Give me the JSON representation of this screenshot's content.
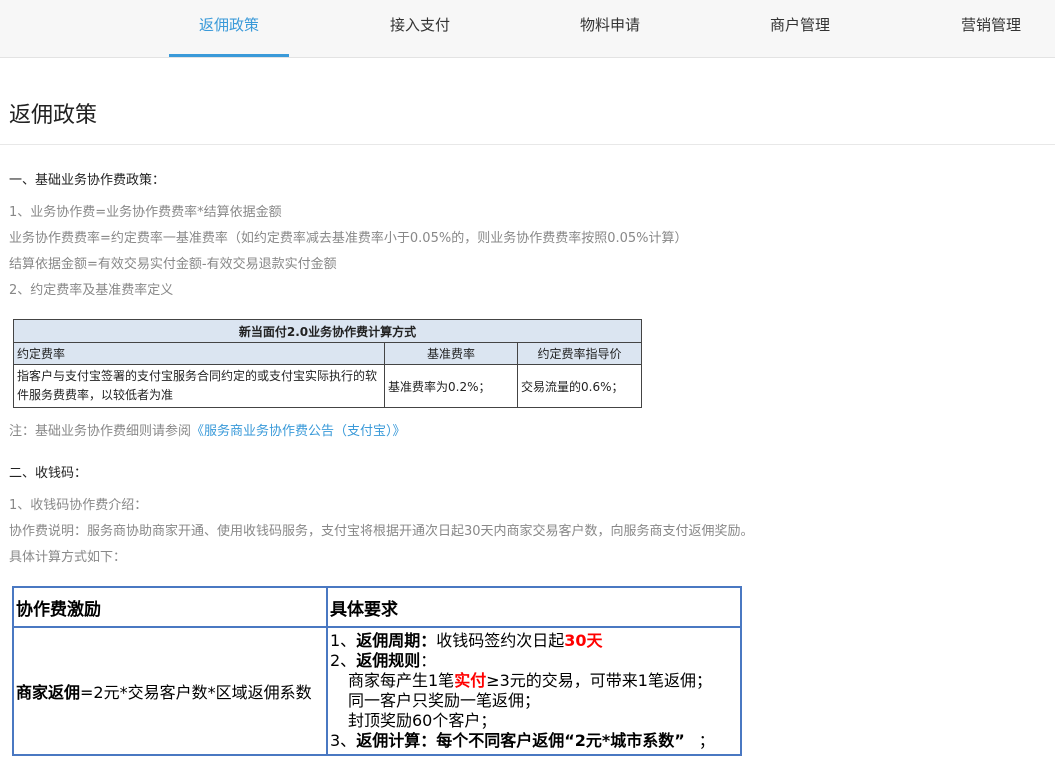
{
  "nav": {
    "items": [
      {
        "label": "返佣政策",
        "active": true
      },
      {
        "label": "接入支付",
        "active": false
      },
      {
        "label": "物料申请",
        "active": false
      },
      {
        "label": "商户管理",
        "active": false
      },
      {
        "label": "营销管理",
        "active": false
      }
    ]
  },
  "page": {
    "title": "返佣政策"
  },
  "section1": {
    "heading": "一、基础业务协作费政策：",
    "lines": [
      "1、业务协作费=业务协作费费率*结算依据金额",
      "业务协作费费率=约定费率一基准费率（如约定费率减去基准费率小于0.05%的，则业务协作费费率按照0.05%计算）",
      "结算依据金额=有效交易实付金额-有效交易退款实付金额",
      "2、约定费率及基准费率定义"
    ],
    "table": {
      "caption": "新当面付2.0业务协作费计算方式",
      "headers": [
        "约定费率",
        "基准费率",
        "约定费率指导价"
      ],
      "row": [
        "指客户与支付宝签署的支付宝服务合同约定的或支付宝实际执行的软件服务费费率，以较低者为准",
        "基准费率为0.2%；",
        "交易流量的0.6%；"
      ]
    },
    "note_prefix": "注：基础业务协作费细则请参阅",
    "note_link": "《服务商业务协作费公告（支付宝）》"
  },
  "section2": {
    "heading": "二、收钱码：",
    "lines": [
      "1、收钱码协作费介绍：",
      "协作费说明：服务商协助商家开通、使用收钱码服务，支付宝将根据开通次日起30天内商家交易客户数，向服务商支付返佣奖励。",
      "具体计算方式如下："
    ],
    "table": {
      "headers": [
        "协作费激励",
        "具体要求"
      ],
      "formula_bold": "商家返佣",
      "formula_rest": "=2元*交易客户数*区域返佣系数",
      "req": {
        "r1_num": "1、",
        "r1_bold": "返佣周期：",
        "r1_text": "收钱码签约次日起",
        "r1_red": "30天",
        "r2_num": "2、",
        "r2_bold": "返佣规则",
        "r2_colon": "：",
        "r2a_pre": "商家每产生1笔",
        "r2a_red": "实付",
        "r2a_post": "≥3元的交易，可带来1笔返佣；",
        "r2b": "同一客户只奖励一笔返佣；",
        "r2c": "封顶奖励60个客户；",
        "r3_num": "3、",
        "r3_bold": "返佣计算：每个不同客户返佣“2元*城市系数”",
        "r3_tail": "；"
      }
    }
  }
}
